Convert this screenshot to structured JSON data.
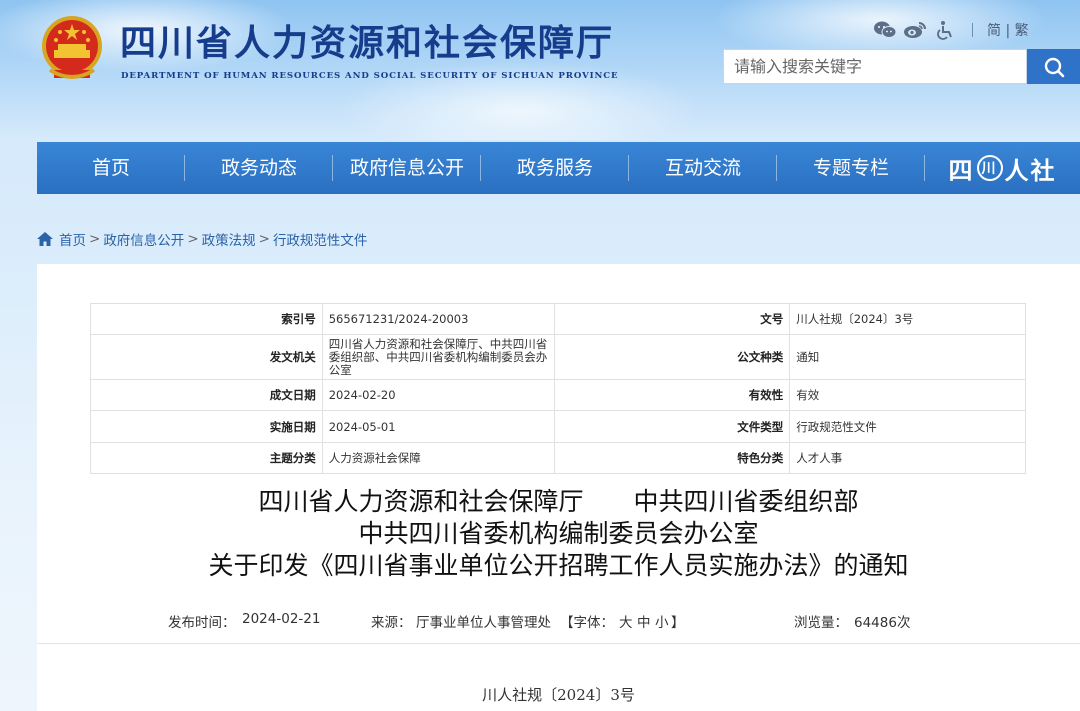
{
  "header": {
    "title": "四川省人力资源和社会保障厅",
    "subtitle": "DEPARTMENT OF HUMAN RESOURCES AND SOCIAL SECURITY OF SICHUAN PROVINCE",
    "lang_switch": "简 | 繁",
    "search": {
      "placeholder": "请输入搜索关键字"
    }
  },
  "nav": {
    "items": [
      "首页",
      "政务动态",
      "政府信息公开",
      "政务服务",
      "互动交流",
      "专题专栏"
    ],
    "brand": {
      "left": "四",
      "circle": "川",
      "right": "人社"
    }
  },
  "breadcrumb": [
    "首页",
    "政府信息公开",
    "政策法规",
    "行政规范性文件"
  ],
  "meta_table": {
    "rows": [
      {
        "k1": "索引号",
        "v1": "565671231/2024-20003",
        "k2": "文号",
        "v2": "川人社规〔2024〕3号"
      },
      {
        "k1": "发文机关",
        "v1": "四川省人力资源和社会保障厅、中共四川省委组织部、中共四川省委机构编制委员会办公室",
        "k2": "公文种类",
        "v2": "通知"
      },
      {
        "k1": "成文日期",
        "v1": "2024-02-20",
        "k2": "有效性",
        "v2": "有效"
      },
      {
        "k1": "实施日期",
        "v1": "2024-05-01",
        "k2": "文件类型",
        "v2": "行政规范性文件"
      },
      {
        "k1": "主题分类",
        "v1": "人力资源社会保障",
        "k2": "特色分类",
        "v2": "人才人事"
      }
    ]
  },
  "document": {
    "title_line1": "四川省人力资源和社会保障厅　　中共四川省委组织部",
    "title_line2": "中共四川省委机构编制委员会办公室",
    "title_line3": "关于印发《四川省事业单位公开招聘工作人员实施办法》的通知",
    "publish_label": "发布时间：",
    "publish_date": "2024-02-21",
    "source_label": "来源：",
    "source": "厅事业单位人事管理处",
    "font_label": "【字体：",
    "font_large": "大",
    "font_medium": "中",
    "font_small": "小",
    "font_close": "】",
    "views_label": "浏览量：",
    "views": "64486次",
    "doc_number": "川人社规〔2024〕3号"
  }
}
